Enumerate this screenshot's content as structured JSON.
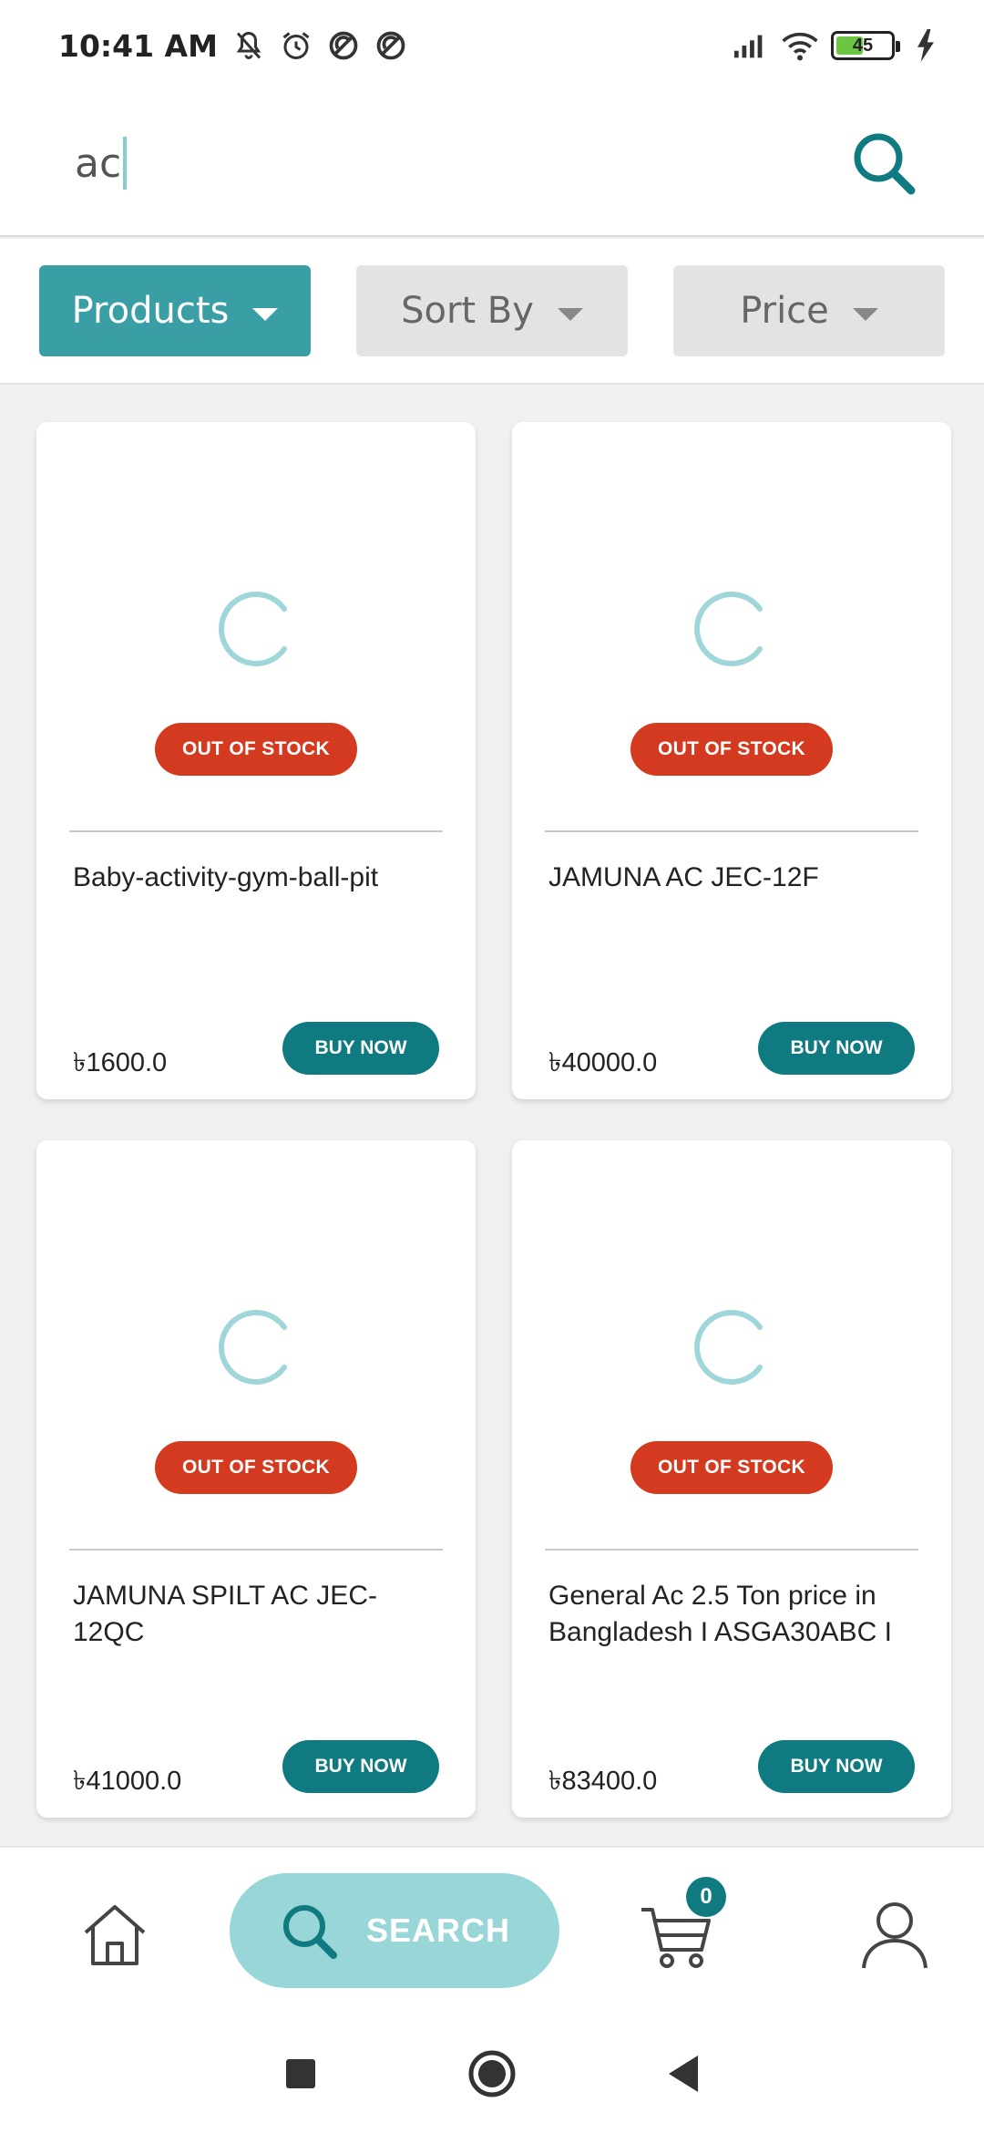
{
  "status_bar": {
    "time": "10:41 AM",
    "battery": "45",
    "icons": [
      "mute-icon",
      "alarm-icon",
      "no-disturb-icon",
      "no-disturb-icon",
      "signal-icon",
      "wifi-icon",
      "battery-icon",
      "charging-icon"
    ]
  },
  "search": {
    "value": "ac",
    "button_icon": "search-icon"
  },
  "filters": {
    "products": "Products",
    "sort_by": "Sort By",
    "price": "Price"
  },
  "colors": {
    "teal": "#0f7b80",
    "teal_light": "#3a9ea5",
    "search_pill": "#98d6d8",
    "out_of_stock": "#d43a1f"
  },
  "products": [
    {
      "name": "Baby-activity-gym-ball-pit",
      "price": "৳1600.0",
      "status": "OUT OF STOCK",
      "button": "BUY NOW"
    },
    {
      "name": "JAMUNA AC JEC-12F",
      "price": "৳40000.0",
      "status": "OUT OF STOCK",
      "button": "BUY NOW"
    },
    {
      "name": "JAMUNA SPILT AC JEC-12QC",
      "price": "৳41000.0",
      "status": "OUT OF STOCK",
      "button": "BUY NOW"
    },
    {
      "name": "General Ac 2.5 Ton price in Bangladesh I ASGA30ABC I",
      "price": "৳83400.0",
      "status": "OUT OF STOCK",
      "button": "BUY NOW"
    }
  ],
  "bottom_nav": {
    "search_label": "SEARCH",
    "cart_count": "0"
  }
}
